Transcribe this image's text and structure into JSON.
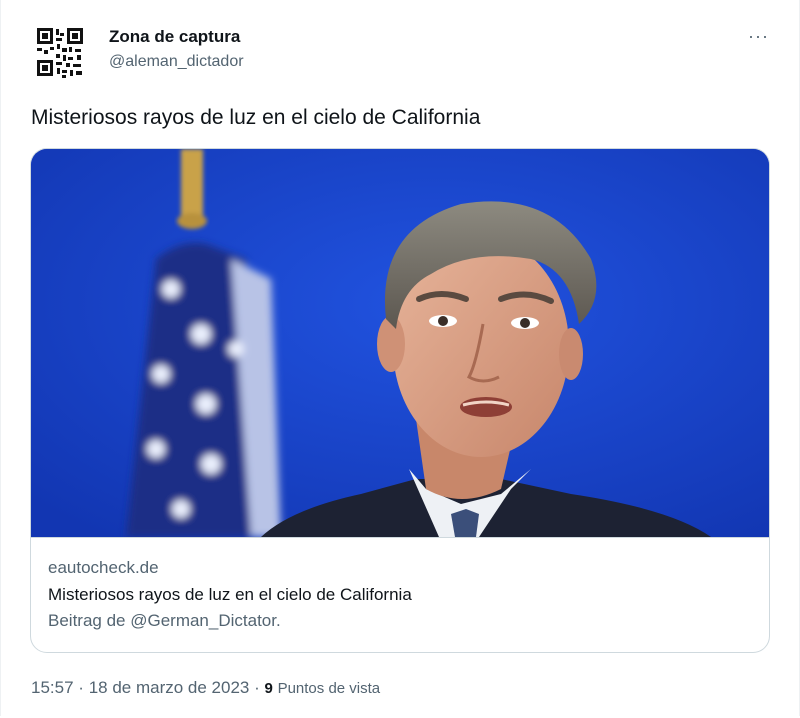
{
  "author": {
    "display_name": "Zona de captura",
    "handle": "@aleman_dictador",
    "avatar_icon": "qr-code-icon"
  },
  "more_icon_glyph": "···",
  "tweet": {
    "text": "Misteriosos rayos de luz en el cielo de California"
  },
  "card": {
    "domain": "eautocheck.de",
    "title": "Misteriosos rayos de luz en el cielo de California",
    "description": "Beitrag de @German_Dictator.",
    "image_background_color": "#1640c5"
  },
  "footer": {
    "time": "15:57",
    "separator": "·",
    "date": "18 de marzo de 2023",
    "views_count": "9",
    "views_label": "Puntos de vista"
  }
}
